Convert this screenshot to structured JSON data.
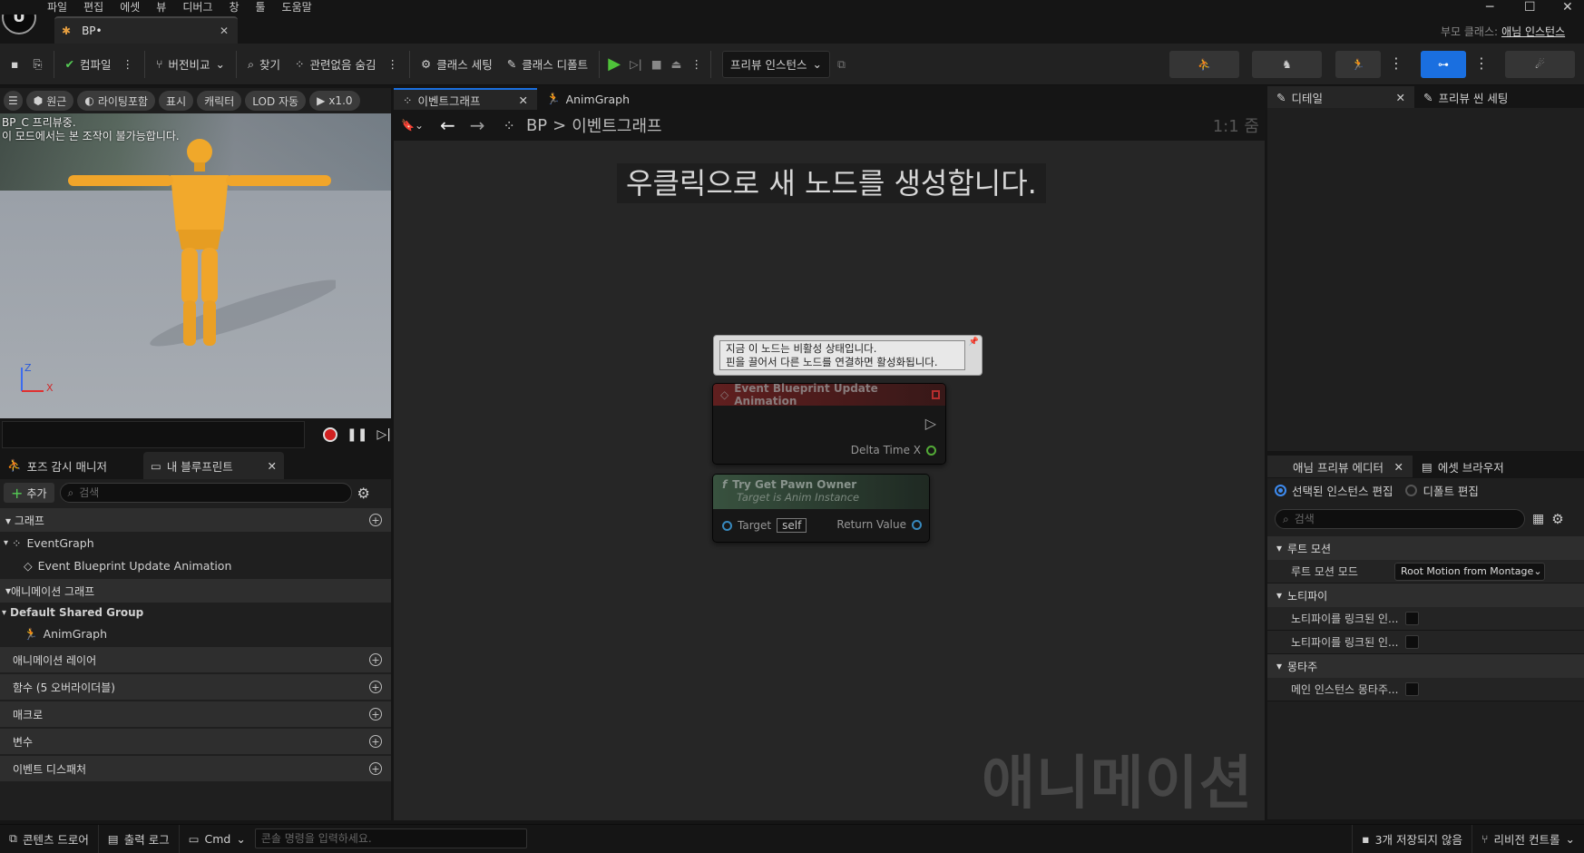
{
  "menu": [
    "파일",
    "편집",
    "에셋",
    "뷰",
    "디버그",
    "창",
    "툴",
    "도움말"
  ],
  "doc_tab": {
    "title": "BP•"
  },
  "parent_class": {
    "label": "부모 클래스:",
    "value": "애님 인스턴스"
  },
  "toolbar": {
    "compile": "컴파일",
    "diff": "버전비교",
    "find": "찾기",
    "hide_unrelated": "관련없음 숨김",
    "class_settings": "클래스 세팅",
    "class_defaults": "클래스 디폴트",
    "preview_instance": "프리뷰 인스턴스"
  },
  "viewport": {
    "perspective": "원근",
    "lit": "라이팅포함",
    "show": "표시",
    "character": "캐릭터",
    "lod": "LOD 자동",
    "speed": "x1.0",
    "overlay_line1": "BP_C 프리뷰중.",
    "overlay_line2": "이 모드에서는 본 조작이 불가능합니다.",
    "axis_z": "Z",
    "axis_x": "X"
  },
  "left_tabs": {
    "pose_watch": "포즈 감시 매니저",
    "my_blueprint": "내 블루프린트"
  },
  "my_blueprint": {
    "add": "추가",
    "search_placeholder": "검색",
    "graphs_header": "그래프",
    "event_graph": "EventGraph",
    "event_update": "Event Blueprint Update Animation",
    "anim_graphs_header": "애니메이션 그래프",
    "default_group": "Default Shared Group",
    "anim_graph": "AnimGraph",
    "anim_layers": "애니메이션 레이어",
    "functions": "함수 (5 오버라이더블)",
    "macros": "매크로",
    "variables": "변수",
    "dispatchers": "이벤트 디스패처"
  },
  "graph_tabs": {
    "event_graph": "이벤트그래프",
    "anim_graph": "AnimGraph"
  },
  "graph": {
    "breadcrumb_root": "BP",
    "breadcrumb_sep": ">",
    "breadcrumb_current": "이벤트그래프",
    "zoom": "1:1 줌",
    "hint": "우클릭으로 새 노드를 생성합니다.",
    "watermark": "애니메이션",
    "comment_line1": "지금 이 노드는 비활성 상태입니다.",
    "comment_line2": "핀을 끌어서 다른 노드를 연결하면 활성화됩니다.",
    "node1_title": "Event Blueprint Update Animation",
    "node1_pin": "Delta Time X",
    "node2_title": "Try Get Pawn Owner",
    "node2_subtitle": "Target is Anim Instance",
    "node2_target": "Target",
    "node2_self": "self",
    "node2_return": "Return Value"
  },
  "right_tabs": {
    "details": "디테일",
    "preview_scene": "프리뷰 씬 세팅"
  },
  "right_tabs2": {
    "anim_preview": "애님 프리뷰 에디터",
    "asset_browser": "에셋 브라우저"
  },
  "preview_editor": {
    "opt_selected": "선택된 인스턴스 편집",
    "opt_defaults": "디폴트 편집",
    "search_placeholder": "검색",
    "root_motion_header": "루트 모션",
    "root_motion_mode": "루트 모션 모드",
    "root_motion_value": "Root Motion from Montage",
    "notify_header": "노티파이",
    "notify1": "노티파이를 링크된 인...",
    "notify2": "노티파이를 링크된 인...",
    "montage_header": "몽타주",
    "montage1": "메인 인스턴스 몽타주..."
  },
  "statusbar": {
    "content_drawer": "콘텐츠 드로어",
    "output_log": "출력 로그",
    "cmd": "Cmd",
    "cmd_placeholder": "콘솔 명령을 입력하세요.",
    "unsaved": "3개 저장되지 않음",
    "source_control": "리비전 컨트롤"
  },
  "colors": {
    "accent": "#1a6fe0",
    "play": "#4fc23a",
    "event_node": "#7a1f1f",
    "pure_node": "#33523a"
  }
}
